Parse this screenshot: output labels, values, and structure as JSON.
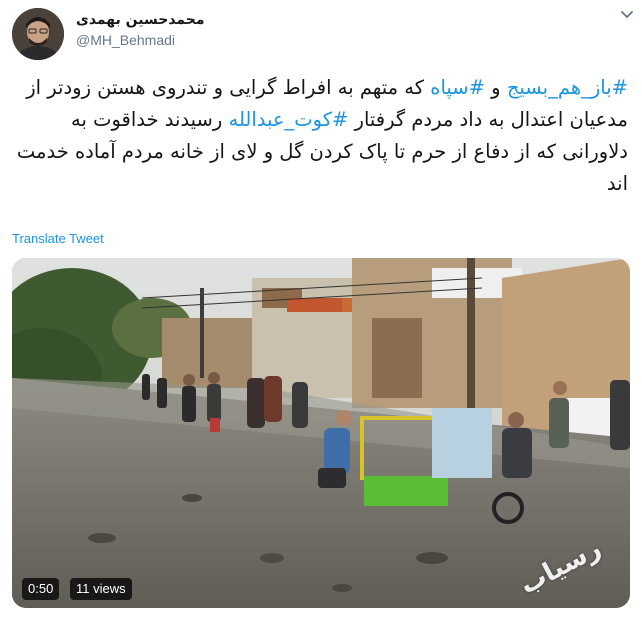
{
  "author": {
    "display_name": "محمدحسین بهمدی",
    "handle": "@MH_Behmadi"
  },
  "tweet": {
    "parts": [
      {
        "text": "#باز_هم_بسیج",
        "hashtag": true
      },
      {
        "text": " و ",
        "hashtag": false
      },
      {
        "text": "#سپاه",
        "hashtag": true
      },
      {
        "text": " که متهم به افراط گرایی و تندروی هستن زودتر از مدعیان اعتدال به داد مردم گرفتار ",
        "hashtag": false
      },
      {
        "text": "#کوت_عبدالله",
        "hashtag": true
      },
      {
        "text": " رسیدند خداقوت به دلاورانی که از دفاع از حرم تا پاک کردن گل و لای از خانه مردم آماده خدمت اند",
        "hashtag": false
      }
    ]
  },
  "translate_label": "Translate Tweet",
  "video": {
    "duration": "0:50",
    "views": "11 views",
    "watermark": "رسیاب"
  },
  "icons": {
    "more": "chevron-down-icon"
  },
  "colors": {
    "link": "#1b95e0",
    "text": "#14171a",
    "muted": "#657786"
  }
}
